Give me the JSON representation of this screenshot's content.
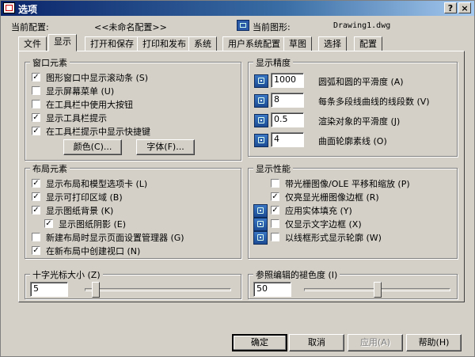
{
  "window": {
    "title": "选项",
    "help_glyph": "?",
    "close_glyph": "×"
  },
  "header": {
    "config_label": "当前配置:",
    "config_value": "<<未命名配置>>",
    "drawing_label": "当前图形:",
    "drawing_value": "Drawing1.dwg"
  },
  "tabs": [
    "文件",
    "显示",
    "打开和保存",
    "打印和发布",
    "系统",
    "用户系统配置",
    "草图",
    "选择",
    "配置"
  ],
  "active_tab": 1,
  "window_elements": {
    "title": "窗口元素",
    "items": [
      {
        "label": "图形窗口中显示滚动条 (S)",
        "checked": true
      },
      {
        "label": "显示屏幕菜单 (U)",
        "checked": false
      },
      {
        "label": "在工具栏中使用大按钮",
        "checked": false
      },
      {
        "label": "显示工具栏提示",
        "checked": true
      },
      {
        "label": "在工具栏提示中显示快捷键",
        "checked": true
      }
    ],
    "color_button": "颜色(C)...",
    "font_button": "字体(F)..."
  },
  "layout_elements": {
    "title": "布局元素",
    "items": [
      {
        "label": "显示布局和模型选项卡 (L)",
        "checked": true
      },
      {
        "label": "显示可打印区域 (B)",
        "checked": true
      },
      {
        "label": "显示图纸背景 (K)",
        "checked": true
      },
      {
        "label": "显示图纸阴影 (E)",
        "checked": true
      },
      {
        "label": "新建布局时显示页面设置管理器 (G)",
        "checked": false
      },
      {
        "label": "在新布局中创建视口 (N)",
        "checked": true
      }
    ]
  },
  "crosshair": {
    "title": "十字光标大小 (Z)",
    "value": "5",
    "slider_fraction": 0.05
  },
  "display_resolution": {
    "title": "显示精度",
    "items": [
      {
        "value": "1000",
        "label": "圆弧和圆的平滑度 (A)"
      },
      {
        "value": "8",
        "label": "每条多段线曲线的线段数 (V)"
      },
      {
        "value": "0.5",
        "label": "渲染对象的平滑度 (J)"
      },
      {
        "value": "4",
        "label": "曲面轮廓素线 (O)"
      }
    ]
  },
  "display_performance": {
    "title": "显示性能",
    "items": [
      {
        "label": "带光栅图像/OLE 平移和缩放 (P)",
        "checked": false
      },
      {
        "label": "仅亮显光栅图像边框 (R)",
        "checked": true
      },
      {
        "label": "应用实体填充 (Y)",
        "checked": true
      },
      {
        "label": "仅显示文字边框 (X)",
        "checked": false
      },
      {
        "label": "以线框形式显示轮廓 (W)",
        "checked": false
      }
    ]
  },
  "xref_fade": {
    "title": "参照编辑的褪色度 (I)",
    "value": "50",
    "slider_fraction": 0.5
  },
  "footer": {
    "ok": "确定",
    "cancel": "取消",
    "apply": "应用(A)",
    "help": "帮助(H)"
  },
  "check_glyph": "✓"
}
